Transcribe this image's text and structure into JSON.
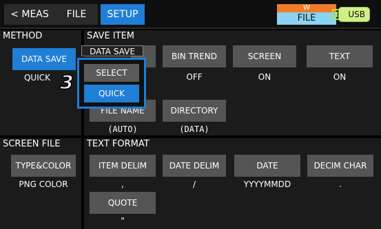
{
  "topbar": {
    "back_label": "< MEAS",
    "file_label": "FILE",
    "setup_label": "SETUP",
    "storage_top": "W",
    "storage_bottom": "FILE",
    "usb_label": "USB",
    "colors": {
      "active_tab": "#1f7ed6",
      "storage_top": "#f07c2a",
      "storage_bottom": "#8ad3f2",
      "usb": "#d0ef8a"
    }
  },
  "method": {
    "title": "METHOD",
    "button_label": "DATA SAVE",
    "value": "QUICK"
  },
  "save_item": {
    "title": "SAVE ITEM",
    "popup": {
      "label": "DATA SAVE",
      "options": [
        "SELECT",
        "QUICK"
      ],
      "selected": "QUICK"
    },
    "marker_number": "3",
    "items": [
      {
        "label": "BIN TREND",
        "value": "OFF"
      },
      {
        "label": "SCREEN",
        "value": "ON"
      },
      {
        "label": "TEXT",
        "value": "ON"
      },
      {
        "label": "FILE NAME",
        "value": "(AUTO)"
      },
      {
        "label": "DIRECTORY",
        "value": "(DATA)"
      }
    ]
  },
  "screen_file": {
    "title": "SCREEN FILE",
    "button_label": "TYPE&COLOR",
    "value": "PNG COLOR"
  },
  "text_format": {
    "title": "TEXT FORMAT",
    "items": [
      {
        "label": "ITEM DELIM",
        "value": ","
      },
      {
        "label": "DATE DELIM",
        "value": "/"
      },
      {
        "label": "DATE",
        "value": "YYYYMMDD"
      },
      {
        "label": "DECIM CHAR",
        "value": "."
      },
      {
        "label": "QUOTE",
        "value": "\""
      }
    ]
  }
}
